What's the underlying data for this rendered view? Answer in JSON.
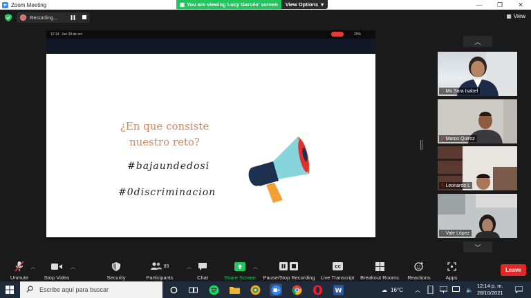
{
  "window": {
    "title": "Zoom Meeting"
  },
  "banner": {
    "viewing_text": "You are viewing Lucy Garcés' screen",
    "view_options": "View Options"
  },
  "recording": {
    "label": "Recording..."
  },
  "topbar": {
    "view_label": "View"
  },
  "phone_status": {
    "time": "12:14",
    "date": "Jue 28 de oct",
    "battery": "25%"
  },
  "slide": {
    "question": "¿En que consiste nuestro reto?",
    "hashtag1": "#bajaundedosi",
    "hashtag2": "#0discriminacion"
  },
  "participants": [
    {
      "name": "Ms Sara Isabel"
    },
    {
      "name": "Marco Quiroz"
    },
    {
      "name": "Leonardo L"
    },
    {
      "name": "Vale López"
    }
  ],
  "toolbar": {
    "unmute": "Unmute",
    "stop_video": "Stop Video",
    "security": "Security",
    "participants": "Participants",
    "participant_count": "89",
    "chat": "Chat",
    "share_screen": "Share Screen",
    "pause_recording": "Pause/Stop Recording",
    "live_transcript": "Live Transcript",
    "breakout_rooms": "Breakout Rooms",
    "reactions": "Reactions",
    "apps": "Apps",
    "leave": "Leave"
  },
  "taskbar": {
    "search_placeholder": "Escribe aquí para buscar",
    "temperature": "16°C",
    "time": "12:14 p. m.",
    "date": "28/10/2021"
  },
  "colors": {
    "accent": "#2d8cff",
    "leave": "#e02828",
    "share": "#23c55e",
    "slide_text": "#d08860"
  }
}
